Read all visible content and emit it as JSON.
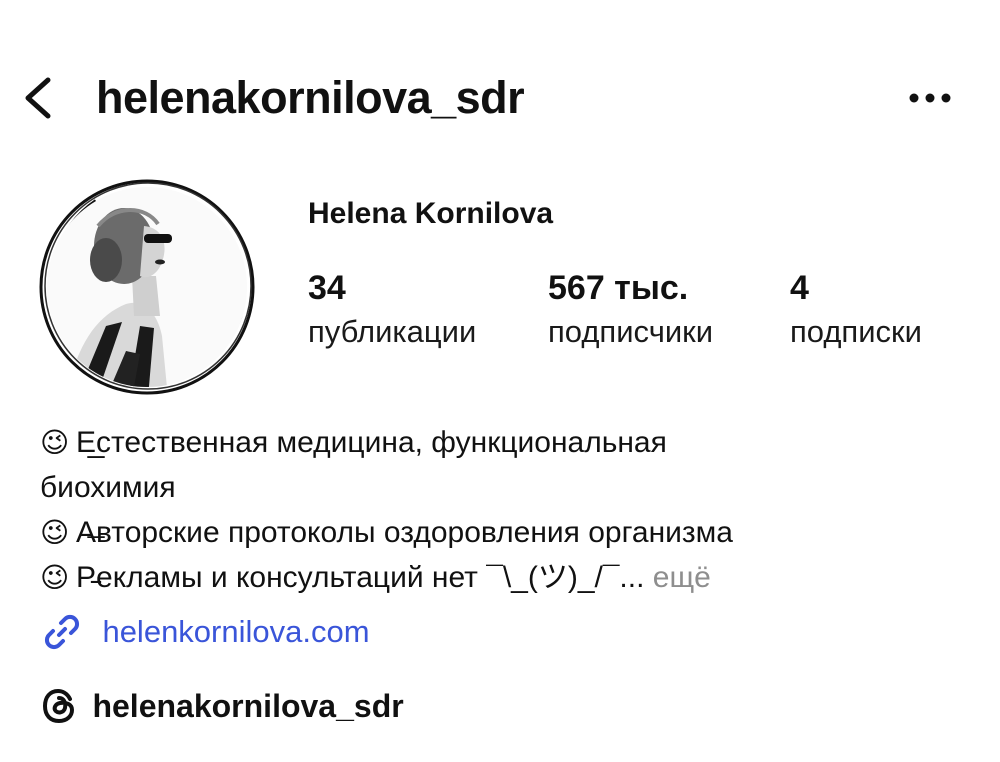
{
  "header": {
    "title": "helenakornilova_sdr",
    "back_icon": "chevron-left-icon",
    "more_icon": "more-horizontal-icon"
  },
  "profile": {
    "display_name": "Helena Kornilova",
    "stats": [
      {
        "value": "34",
        "label": "публикации"
      },
      {
        "value": "567 тыс.",
        "label": "подписчики"
      },
      {
        "value": "4",
        "label": "подписки"
      }
    ]
  },
  "bio": {
    "emoji": "😉",
    "line1": "Е̲стественная медицина, функциональная",
    "line2": "биохимия",
    "line3": "А̶вторские протоколы оздоровления организма",
    "line4": "Р̵екламы и консультаций нет ¯\\_(ツ)_/¯...",
    "more_label": "ещё"
  },
  "website": {
    "icon": "link-icon",
    "text": "helenkornilova.com"
  },
  "threads": {
    "icon": "threads-icon",
    "text": "helenakornilova_sdr"
  },
  "colors": {
    "link": "#3a55d9",
    "muted": "#8e8e8e",
    "text": "#111111"
  }
}
